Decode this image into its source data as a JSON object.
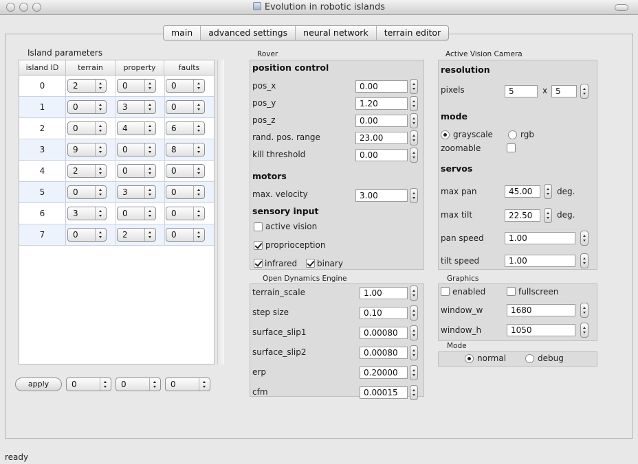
{
  "window": {
    "title": "Evolution in robotic islands"
  },
  "tabs": [
    "main",
    "advanced settings",
    "neural network",
    "terrain editor"
  ],
  "island": {
    "title": "Island parameters",
    "columns": [
      "island ID",
      "terrain",
      "property",
      "faults"
    ],
    "rows": [
      [
        "0",
        "2",
        "0",
        "0"
      ],
      [
        "1",
        "0",
        "3",
        "0"
      ],
      [
        "2",
        "0",
        "4",
        "6"
      ],
      [
        "3",
        "9",
        "0",
        "8"
      ],
      [
        "4",
        "2",
        "0",
        "0"
      ],
      [
        "5",
        "0",
        "3",
        "0"
      ],
      [
        "6",
        "3",
        "0",
        "0"
      ],
      [
        "7",
        "0",
        "2",
        "0"
      ]
    ],
    "apply_label": "apply",
    "apply_values": [
      "0",
      "0",
      "0"
    ]
  },
  "rover": {
    "title": "Rover",
    "position_control": "position control",
    "pos": [
      {
        "label": "pos_x",
        "value": "0.00"
      },
      {
        "label": "pos_y",
        "value": "1.20"
      },
      {
        "label": "pos_z",
        "value": "0.00"
      },
      {
        "label": "rand. pos. range",
        "value": "23.00"
      },
      {
        "label": "kill threshold",
        "value": "0.00"
      }
    ],
    "motors": "motors",
    "max_velocity_label": "max. velocity",
    "max_velocity": "3.00",
    "sensory": "sensory input",
    "active_vision": "active vision",
    "proprioception": "proprioception",
    "infrared": "infrared",
    "binary": "binary"
  },
  "ode": {
    "title": "Open Dynamics Engine",
    "params": [
      {
        "label": "terrain_scale",
        "value": "1.00"
      },
      {
        "label": "step size",
        "value": "0.10"
      },
      {
        "label": "surface_slip1",
        "value": "0.00080"
      },
      {
        "label": "surface_slip2",
        "value": "0.00080"
      },
      {
        "label": "erp",
        "value": "0.20000"
      },
      {
        "label": "cfm",
        "value": "0.00015"
      }
    ]
  },
  "camera": {
    "title": "Active Vision Camera",
    "resolution": "resolution",
    "pixels_label": "pixels",
    "px_w": "5",
    "x": "x",
    "px_h": "5",
    "mode": "mode",
    "grayscale": "grayscale",
    "rgb": "rgb",
    "zoomable": "zoomable",
    "servos": "servos",
    "max_pan_label": "max pan",
    "max_pan": "45.00",
    "deg": "deg.",
    "max_tilt_label": "max tilt",
    "max_tilt": "22.50",
    "pan_speed_label": "pan speed",
    "pan_speed": "1.00",
    "tilt_speed_label": "tilt speed",
    "tilt_speed": "1.00"
  },
  "graphics": {
    "title": "Graphics",
    "enabled": "enabled",
    "fullscreen": "fullscreen",
    "window_w_label": "window_w",
    "window_w": "1680",
    "window_h_label": "window_h",
    "window_h": "1050"
  },
  "mode": {
    "title": "Mode",
    "normal": "normal",
    "debug": "debug"
  },
  "status": "ready"
}
